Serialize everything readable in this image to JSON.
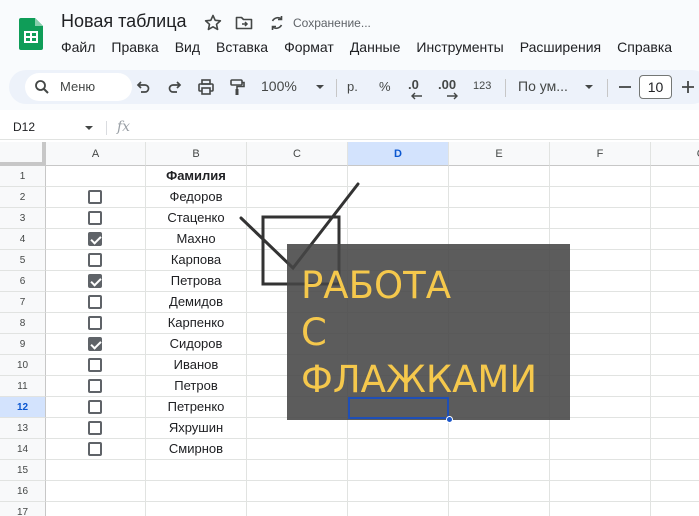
{
  "app": {
    "title": "Новая таблица",
    "save_status": "Сохранение..."
  },
  "menu": [
    "Файл",
    "Правка",
    "Вид",
    "Вставка",
    "Формат",
    "Данные",
    "Инструменты",
    "Расширения",
    "Справка"
  ],
  "toolbar": {
    "search_label": "Меню",
    "zoom": "100%",
    "currency": "р.",
    "percent": "%",
    "decrease_decimals": ".0",
    "increase_decimals": ".00",
    "number_format": "123",
    "font": "По ум...",
    "font_size": "10"
  },
  "formula_bar": {
    "cell_ref": "D12",
    "fx": "fx",
    "content": ""
  },
  "columns": [
    "A",
    "B",
    "C",
    "D",
    "E",
    "F",
    "G"
  ],
  "selected_column": "D",
  "selected_row": 12,
  "rows": [
    {
      "n": "1",
      "name": "Фамилия",
      "checkbox": null,
      "bold": true
    },
    {
      "n": "2",
      "name": "Федоров",
      "checkbox": false
    },
    {
      "n": "3",
      "name": "Стаценко",
      "checkbox": false
    },
    {
      "n": "4",
      "name": "Махно",
      "checkbox": true
    },
    {
      "n": "5",
      "name": "Карпова",
      "checkbox": false
    },
    {
      "n": "6",
      "name": "Петрова",
      "checkbox": true
    },
    {
      "n": "7",
      "name": "Демидов",
      "checkbox": false
    },
    {
      "n": "8",
      "name": "Карпенко",
      "checkbox": false
    },
    {
      "n": "9",
      "name": "Сидоров",
      "checkbox": true
    },
    {
      "n": "10",
      "name": "Иванов",
      "checkbox": false
    },
    {
      "n": "11",
      "name": "Петров",
      "checkbox": false
    },
    {
      "n": "12",
      "name": "Петренко",
      "checkbox": false
    },
    {
      "n": "13",
      "name": "Яхрушин",
      "checkbox": false
    },
    {
      "n": "14",
      "name": "Смирнов",
      "checkbox": false
    },
    {
      "n": "15",
      "name": "",
      "checkbox": null
    },
    {
      "n": "16",
      "name": "",
      "checkbox": null
    },
    {
      "n": "17",
      "name": "",
      "checkbox": null
    }
  ],
  "overlay": {
    "lines": [
      "РАБОТА",
      "С",
      "ФЛАЖКАМИ"
    ],
    "text_color": "#f5c84c",
    "background": "#464646"
  },
  "colors": {
    "accent": "#0b57d0",
    "logo_green": "#0f9d58"
  }
}
